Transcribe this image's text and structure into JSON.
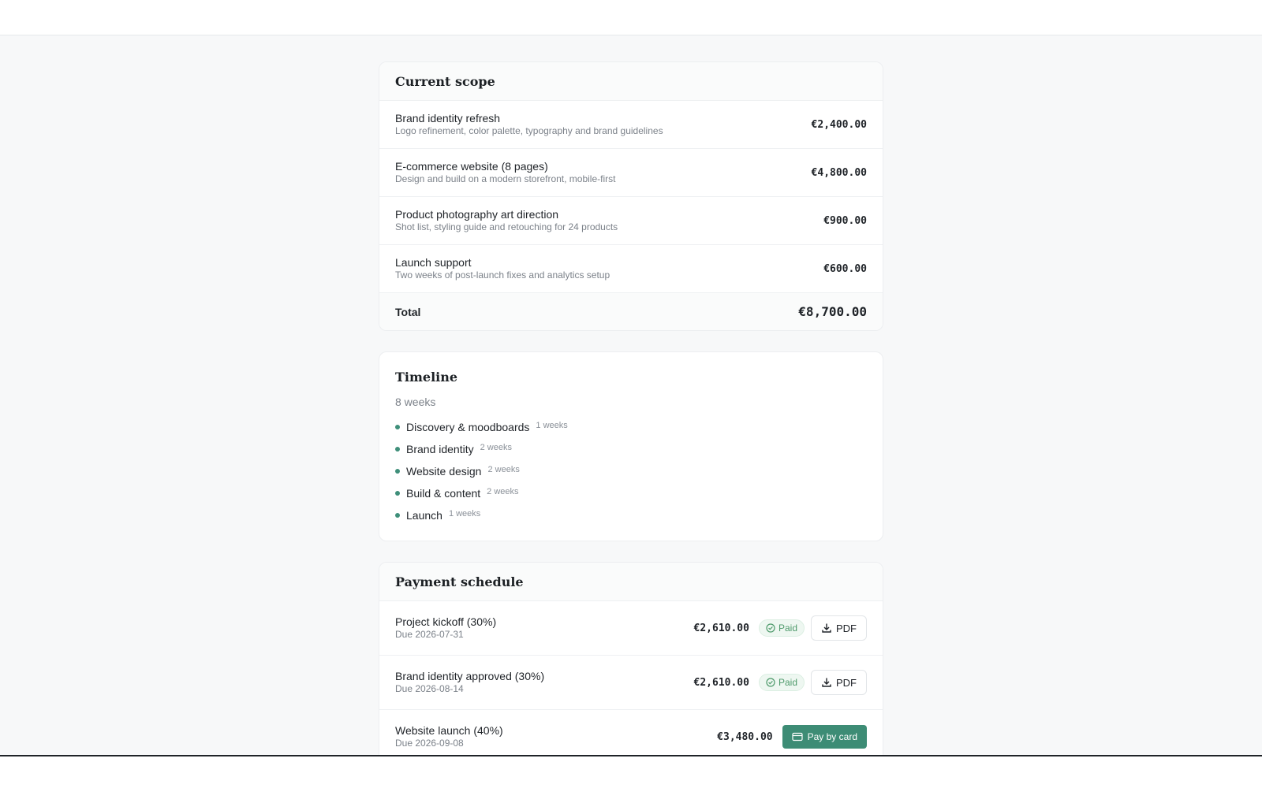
{
  "scope": {
    "title": "Current scope",
    "items": [
      {
        "title": "Brand identity refresh",
        "desc": "Logo refinement, color palette, typography and brand guidelines",
        "amount": "€2,400.00"
      },
      {
        "title": "E-commerce website (8 pages)",
        "desc": "Design and build on a modern storefront, mobile-first",
        "amount": "€4,800.00"
      },
      {
        "title": "Product photography art direction",
        "desc": "Shot list, styling guide and retouching for 24 products",
        "amount": "€900.00"
      },
      {
        "title": "Launch support",
        "desc": "Two weeks of post-launch fixes and analytics setup",
        "amount": "€600.00"
      }
    ],
    "total_label": "Total",
    "total_amount": "€8,700.00"
  },
  "timeline": {
    "title": "Timeline",
    "duration": "8 weeks",
    "phases": [
      {
        "name": "Discovery & moodboards",
        "duration": "1 weeks"
      },
      {
        "name": "Brand identity",
        "duration": "2 weeks"
      },
      {
        "name": "Website design",
        "duration": "2 weeks"
      },
      {
        "name": "Build & content",
        "duration": "2 weeks"
      },
      {
        "name": "Launch",
        "duration": "1 weeks"
      }
    ]
  },
  "payments": {
    "title": "Payment schedule",
    "items": [
      {
        "title": "Project kickoff (30%)",
        "due": "Due 2026-07-31",
        "amount": "€2,610.00",
        "status": "Paid",
        "action": "PDF"
      },
      {
        "title": "Brand identity approved (30%)",
        "due": "Due 2026-08-14",
        "amount": "€2,610.00",
        "status": "Paid",
        "action": "PDF"
      },
      {
        "title": "Website launch (40%)",
        "due": "Due 2026-09-08",
        "amount": "€3,480.00",
        "action": "Pay by card"
      }
    ]
  },
  "colors": {
    "accent": "#3d8c75",
    "paid_text": "#4e9a6b",
    "paid_bg": "#eef7f1"
  },
  "icons": {
    "paid": "check-circle-icon",
    "pdf": "download-icon",
    "pay": "credit-card-icon",
    "bullet": "dot-icon"
  }
}
